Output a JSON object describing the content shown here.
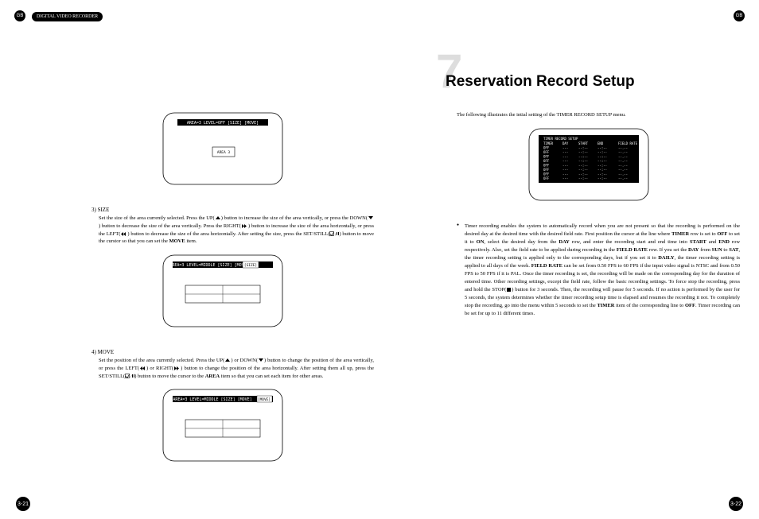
{
  "header": {
    "gb": "GB",
    "title": "DIGITAL VIDEO RECORDER"
  },
  "chapter": {
    "number": "7",
    "title": "Reservation Record Setup"
  },
  "screens": {
    "s1": {
      "menu": "AREA=3 LEVEL=OFF [SIZE] [MOVE]",
      "label": "AREA 3"
    },
    "s2": {
      "menu": "AREA=3 LEVEL=MIDDLE [SIZE] [MOVE]"
    },
    "s3": {
      "menu": "AREA=3 LEVEL=MIDDLE [SIZE] [MOVE]"
    }
  },
  "left": {
    "size": {
      "title": "3) SIZE",
      "body_a": "Set the size of the area currently selected. Press the UP(",
      "body_b": ") button to increase the size of the area vertically, or press the DOWN(",
      "body_c": ") button to decrease the size of the area vertically. Press the RIGHT(",
      "body_d": ") button to increase the size of the area horizontally, or press the LEFT(",
      "body_e": ") button to decrease the size of the area horizontally. After setting the size, press the SET/STILL(",
      "body_f": ") button to move the curstor so that you can set the ",
      "body_g": " item."
    },
    "move": {
      "title": "4) MOVE",
      "body_a": "Set the position of the area currently selected. Press the UP(",
      "body_b": ") or DOWN(",
      "body_c": ") button to change the position of the area vertically, or press the LEFT(",
      "body_d": ") or RIGHT(",
      "body_e": ") button to change the position of the area horizontally. After setting them all up, press the SET/STILL(",
      "body_f": ") button to move the cursor to the ",
      "body_g": " item so that you can set each item for other areas."
    },
    "bold": {
      "move": "MOVE",
      "area": "AREA"
    }
  },
  "right": {
    "intro": "The following illustrates the intial setting of the TIMER RECORD SETUP menu.",
    "bullet_a": "Timer recording enables the system to automatically record when you are not present so that the recording is performed on the desired day at the desired time with the desired field rate. First position the cursor at the line where ",
    "bullet_b": " row is set to ",
    "bullet_c": " to set it to ",
    "bullet_d": ", select the desired day from the ",
    "bullet_e": " row, and enter the recording start and end time into ",
    "bullet_f": " and ",
    "bullet_g": " row respectively. Also, set the field rate to be applied during recording in the ",
    "bullet_h": " row. If you set the ",
    "bullet_i": " from ",
    "bullet_j": " to ",
    "bullet_k": ", the timer recording setting is applied only to the corresponding days, but if you set it to ",
    "bullet_l": ", the timer recording setting is applied to all days of the week. ",
    "bullet_m": " can be set from 0.50 FPS to 60 FPS if the input video signal is NTSC and from 0.50 FPS to 50 FPS if it is PAL. Once the timer recording is set, the recording will be made on the corresponding day for the duration of entered time. Other recording settings, except the field rate, follow the basic recording settings. To force stop the recording, press and hold the STOP(",
    "bullet_n": ") button for 3 seconds. Then, the recording will pause for 5 seconds. If no action is performed by the user for 5 seconds, the system determines whether the timer recording setup time is elapsed and resumes the recording it not. To completely stop the recording, go into the menu within 5 seconds to set the ",
    "bullet_o": " item of the corresponding line to ",
    "bullet_p": ". Timer recording can be set for up to 11 different times.",
    "bold": {
      "timer": "TIMER",
      "off": "OFF",
      "on": "ON",
      "day": "DAY",
      "start": "START",
      "end": "END",
      "fieldrate": "FIELD RATE",
      "sun": "SUN",
      "sat": "SAT",
      "daily": "DAILY"
    }
  },
  "chart_data": {
    "type": "table",
    "title": "TIMER RECORD SETUP",
    "columns": [
      "TIMER",
      "DAY",
      "START",
      "END",
      "FIELD RATE"
    ],
    "rows": [
      [
        "OFF",
        "---",
        "--:--",
        "--:--",
        "--.--"
      ],
      [
        "OFF",
        "---",
        "--:--",
        "--:--",
        "--.--"
      ],
      [
        "OFF",
        "---",
        "--:--",
        "--:--",
        "--.--"
      ],
      [
        "OFF",
        "---",
        "--:--",
        "--:--",
        "--.--"
      ],
      [
        "OFF",
        "---",
        "--:--",
        "--:--",
        "--.--"
      ],
      [
        "OFF",
        "---",
        "--:--",
        "--:--",
        "--.--"
      ],
      [
        "OFF",
        "---",
        "--:--",
        "--:--",
        "--.--"
      ],
      [
        "OFF",
        "---",
        "--:--",
        "--:--",
        "--.--"
      ]
    ]
  },
  "pages": {
    "left": "3-21",
    "right": "3-22"
  }
}
